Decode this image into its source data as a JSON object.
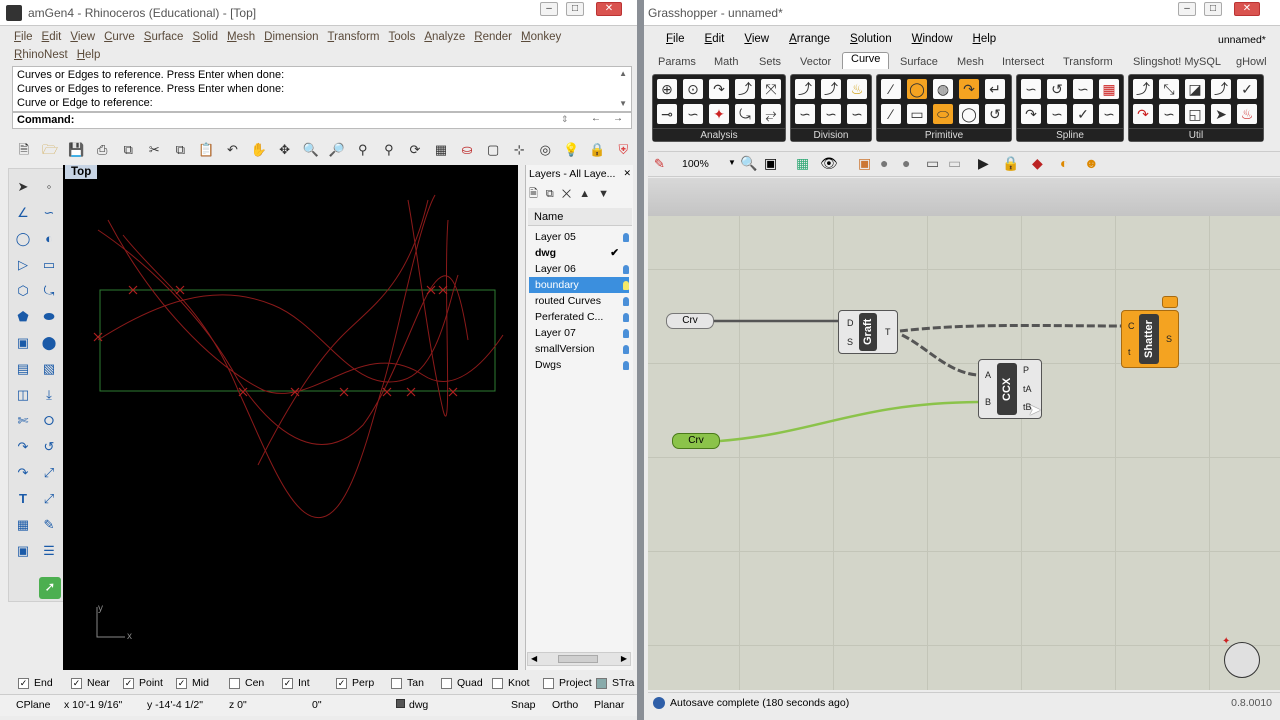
{
  "rhino": {
    "title": "amGen4 - Rhinoceros (Educational) - [Top]",
    "menu": [
      "File",
      "Edit",
      "View",
      "Curve",
      "Surface",
      "Solid",
      "Mesh",
      "Dimension",
      "Transform",
      "Tools",
      "Analyze",
      "Render",
      "Monkey",
      "RhinoNest",
      "Help"
    ],
    "history": [
      "Curves or Edges to reference. Press Enter when done:",
      "Curves or Edges to reference. Press Enter when done:",
      "Curve or Edge to reference:"
    ],
    "command_label": "Command:",
    "viewport_label": "Top",
    "axis_y": "y",
    "axis_x": "x",
    "layers": {
      "title": "Layers - All Laye...",
      "header": "Name",
      "rows": [
        {
          "name": "Layer 05"
        },
        {
          "name": "dwg"
        },
        {
          "name": "Layer 06"
        },
        {
          "name": "boundary"
        },
        {
          "name": "routed Curves"
        },
        {
          "name": "Perferated C..."
        },
        {
          "name": "Layer 07"
        },
        {
          "name": "smallVersion"
        },
        {
          "name": "Dwgs"
        }
      ]
    },
    "snaps": [
      {
        "label": "End",
        "checked": true
      },
      {
        "label": "Near",
        "checked": true
      },
      {
        "label": "Point",
        "checked": true
      },
      {
        "label": "Mid",
        "checked": true
      },
      {
        "label": "Cen",
        "checked": false
      },
      {
        "label": "Int",
        "checked": true
      },
      {
        "label": "Perp",
        "checked": true
      },
      {
        "label": "Tan",
        "checked": false
      },
      {
        "label": "Quad",
        "checked": false
      },
      {
        "label": "Knot",
        "checked": false
      },
      {
        "label": "Project",
        "checked": false
      },
      {
        "label": "STra",
        "checked": false
      }
    ],
    "status": {
      "cplane": "CPlane",
      "x": "x 10'-1 9/16\"",
      "y": "y -14'-4 1/2\"",
      "z": "z 0\"",
      "z2": "0\"",
      "layer": "dwg",
      "snap": "Snap",
      "ortho": "Ortho",
      "planar": "Planar"
    }
  },
  "gh": {
    "title": "Grasshopper - unnamed*",
    "doc_name": "unnamed*",
    "menu": [
      "File",
      "Edit",
      "View",
      "Arrange",
      "Solution",
      "Window",
      "Help"
    ],
    "tabs": [
      "Params",
      "Math",
      "Sets",
      "Vector",
      "Curve",
      "Surface",
      "Mesh",
      "Intersect",
      "Transform",
      "Slingshot! MySQL",
      "gHowl"
    ],
    "active_tab": "Curve",
    "panels": [
      "Analysis",
      "Division",
      "Primitive",
      "Spline",
      "Util"
    ],
    "zoom": "100%",
    "components": {
      "crv1": "Crv",
      "crv2": "Crv",
      "graft": "Graft",
      "graft_in": [
        "D",
        "S"
      ],
      "graft_out": "T",
      "ccx": "CCX",
      "ccx_in": [
        "A",
        "B"
      ],
      "ccx_out": [
        "P",
        "tA",
        "tB"
      ],
      "shatter": "Shatter",
      "shatter_in": [
        "C",
        "t"
      ],
      "shatter_out": "S"
    },
    "status": "Autosave complete (180 seconds ago)",
    "version": "0.8.0010"
  },
  "colors": {
    "curve": "#8b1a1a",
    "boundary": "#2e7d32",
    "shatter": "#f4a321",
    "wire_green": "#8bc34a"
  }
}
